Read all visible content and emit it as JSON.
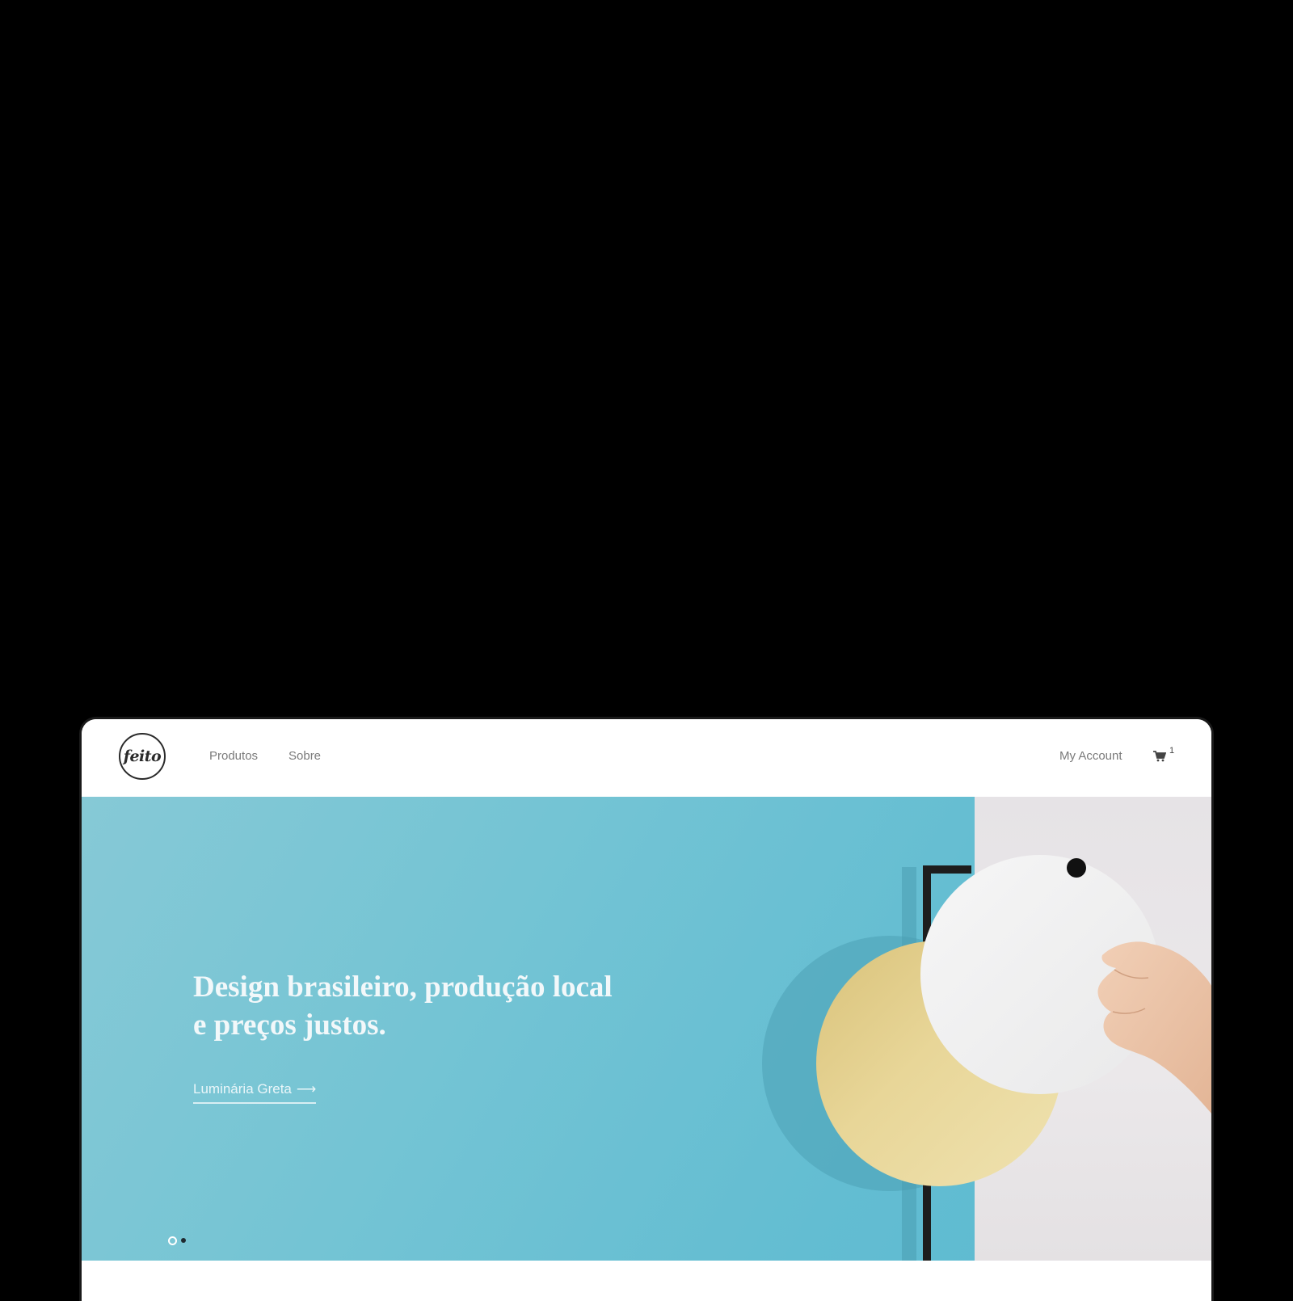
{
  "header": {
    "logo_text": "feito",
    "nav": {
      "produtos": "Produtos",
      "sobre": "Sobre",
      "my_account": "My Account"
    },
    "cart": {
      "icon": "cart-icon",
      "count": "1"
    }
  },
  "hero": {
    "title_line1": "Design brasileiro, produção local",
    "title_line2": "e preços justos.",
    "cta_label": "Luminária Greta",
    "cta_arrow": "⟶",
    "slider": {
      "total": 2,
      "active": 1
    }
  },
  "colors": {
    "background": "#000000",
    "hero_blue": "#63bdd2",
    "hero_panel": "#e9e6e8",
    "brass": "#e4cf8a",
    "text_nav": "#7a7a7a"
  }
}
